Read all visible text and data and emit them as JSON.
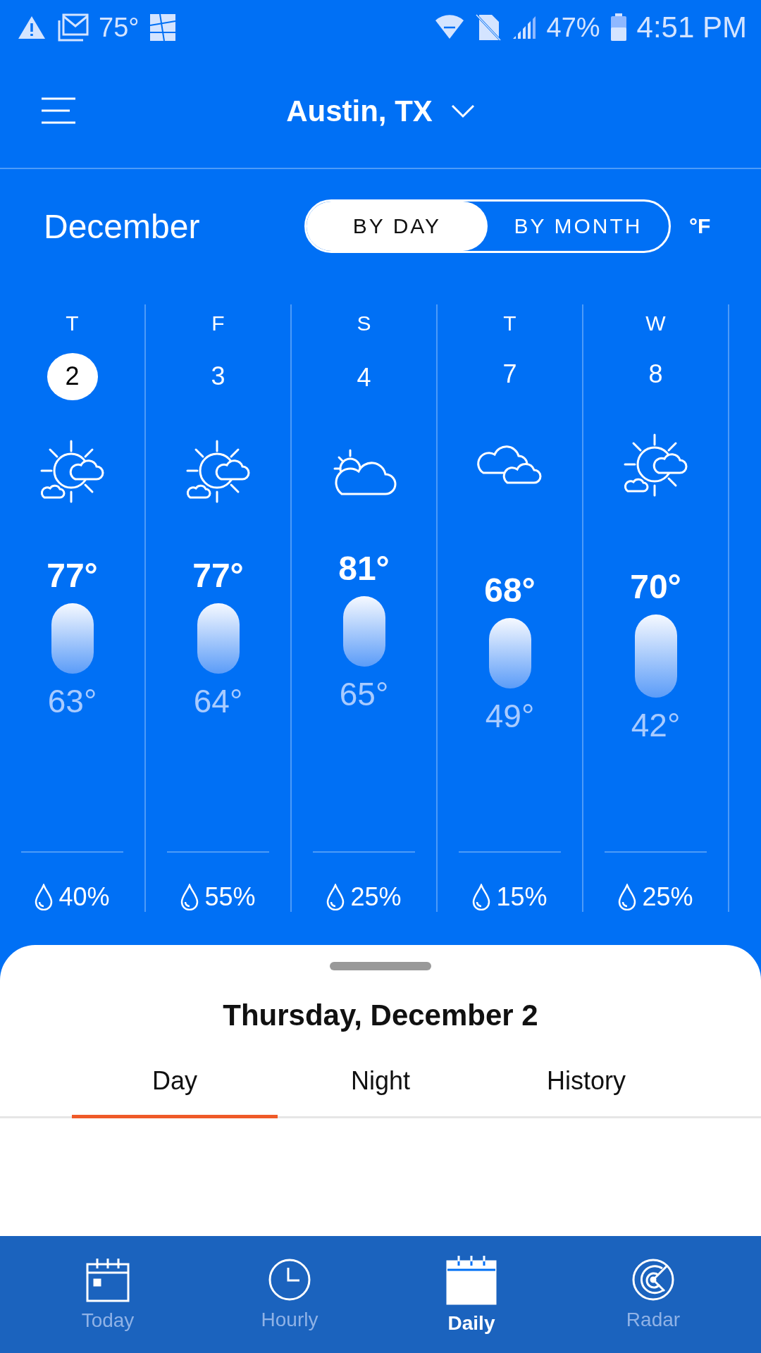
{
  "status_bar": {
    "left_text": "75°",
    "battery": "47%",
    "time": "4:51 PM"
  },
  "header": {
    "location": "Austin, TX"
  },
  "month": "December",
  "view_toggle": [
    {
      "label": "BY DAY",
      "selected": true
    },
    {
      "label": "BY MONTH",
      "selected": false
    }
  ],
  "unit": "°F",
  "days": [
    {
      "weekday": "T",
      "date": "2",
      "selected": true,
      "kind": "partly-sunny",
      "high": "77°",
      "low": "63°",
      "precip": "40%"
    },
    {
      "weekday": "F",
      "date": "3",
      "selected": false,
      "kind": "partly-sunny",
      "high": "77°",
      "low": "64°",
      "precip": "55%"
    },
    {
      "weekday": "S",
      "date": "4",
      "selected": false,
      "kind": "mostly-cloudy",
      "high": "81°",
      "low": "65°",
      "precip": "25%"
    },
    {
      "weekday": "T",
      "date": "7",
      "selected": false,
      "kind": "cloudy",
      "high": "68°",
      "low": "49°",
      "precip": "15%"
    },
    {
      "weekday": "W",
      "date": "8",
      "selected": false,
      "kind": "partly-sunny",
      "high": "70°",
      "low": "42°",
      "precip": "25%"
    }
  ],
  "detail": {
    "title": "Thursday, December 2",
    "tabs": [
      {
        "label": "Day",
        "selected": true
      },
      {
        "label": "Night",
        "selected": false
      },
      {
        "label": "History",
        "selected": false
      }
    ]
  },
  "bottom_nav": [
    {
      "label": "Today",
      "selected": false
    },
    {
      "label": "Hourly",
      "selected": false
    },
    {
      "label": "Daily",
      "selected": true
    },
    {
      "label": "Radar",
      "selected": false
    }
  ]
}
